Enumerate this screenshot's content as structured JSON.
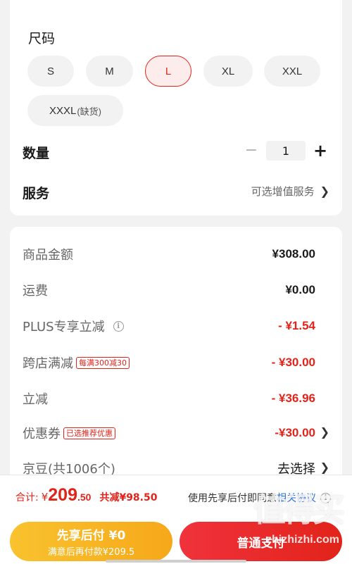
{
  "size": {
    "title": "尺码",
    "options": [
      {
        "label": "S",
        "sub": ""
      },
      {
        "label": "M",
        "sub": ""
      },
      {
        "label": "L",
        "sub": ""
      },
      {
        "label": "XL",
        "sub": ""
      },
      {
        "label": "XXL",
        "sub": ""
      },
      {
        "label": "XXXL",
        "sub": "(缺货)"
      }
    ],
    "selected": "L"
  },
  "quantity": {
    "label": "数量",
    "minus": "−",
    "value": "1",
    "plus": "+"
  },
  "service": {
    "label": "服务",
    "value": "可选增值服务"
  },
  "summary": {
    "goods_amount": {
      "label": "商品金额",
      "value": "¥308.00"
    },
    "shipping": {
      "label": "运费",
      "value": "¥0.00"
    },
    "plus_discount": {
      "label": "PLUS专享立减",
      "value": "- ¥1.54"
    },
    "cross_store": {
      "label": "跨店满减",
      "tag": "每满300减30",
      "value": "- ¥30.00"
    },
    "instant": {
      "label": "立减",
      "value": "- ¥36.96"
    },
    "coupon": {
      "label": "优惠券",
      "tag": "已选推荐优惠",
      "value": "-¥30.00"
    },
    "jingdou": {
      "label": "京豆(共1006个)",
      "value": "去选择"
    }
  },
  "footer": {
    "total_label": "合计:",
    "yen": "¥",
    "total_int": "209",
    "total_dec": ".50",
    "saved": "共减¥98.50",
    "agree_text": "使用先享后付即同意",
    "agree_link": "相关协议",
    "pay_later_line1": "先享后付 ¥0",
    "pay_later_line2": "满意后再付款¥209.5",
    "normal_pay": "普通支付"
  },
  "watermark": {
    "glyphs": "值得买",
    "url": "zhizhizhi.com"
  },
  "colors": {
    "accent": "#e2231a",
    "gold": "#f6a81a",
    "link": "#2a6fd6"
  }
}
